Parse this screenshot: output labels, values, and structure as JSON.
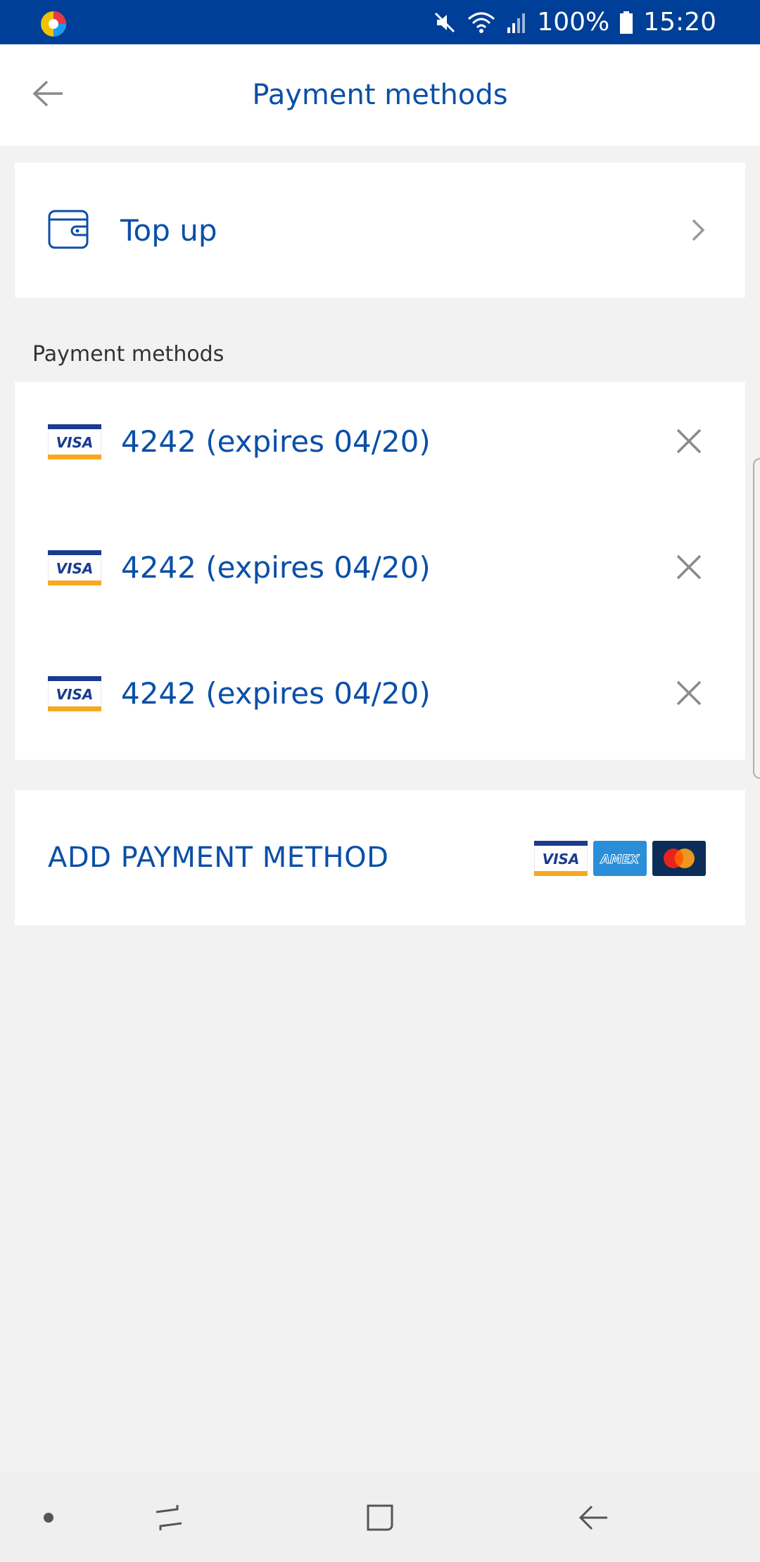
{
  "status_bar": {
    "battery": "100%",
    "time": "15:20",
    "icons": [
      "app-logo-icon",
      "mute-icon",
      "wifi-icon",
      "signal-icon",
      "battery-icon"
    ]
  },
  "header": {
    "title": "Payment methods",
    "back_icon": "back-arrow-icon"
  },
  "top_up": {
    "label": "Top up",
    "icon": "wallet-icon"
  },
  "payment_methods": {
    "section_label": "Payment methods",
    "items": [
      {
        "brand": "VISA",
        "label": "4242 (expires 04/20)"
      },
      {
        "brand": "VISA",
        "label": "4242 (expires 04/20)"
      },
      {
        "brand": "VISA",
        "label": "4242 (expires 04/20)"
      }
    ]
  },
  "add_method": {
    "label": "ADD PAYMENT METHOD",
    "logos": [
      "VISA",
      "AMEX",
      "mastercard"
    ]
  },
  "nav_bar": {
    "buttons": [
      "dot-icon",
      "recent-apps-icon",
      "home-icon",
      "back-icon"
    ]
  },
  "colors": {
    "status_bar": "#003f97",
    "accent": "#0b4fa8",
    "background": "#f2f2f2"
  }
}
